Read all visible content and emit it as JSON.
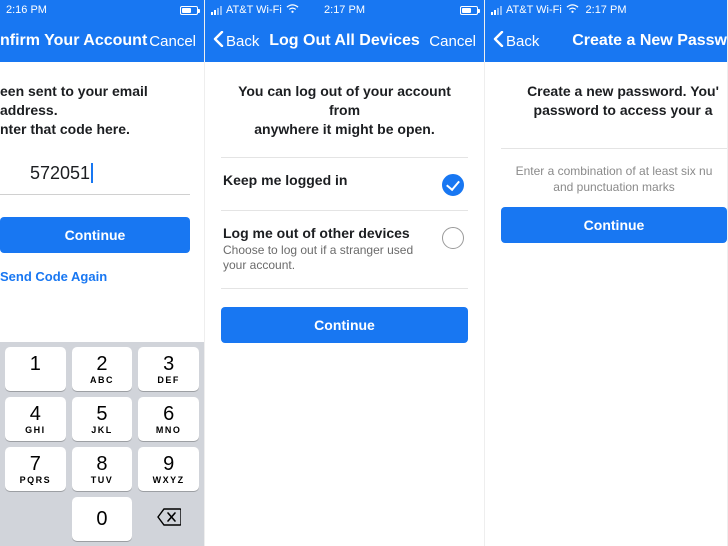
{
  "screen1": {
    "status": {
      "time": "2:16 PM"
    },
    "nav": {
      "title": "nfirm Your Account",
      "cancel": "Cancel"
    },
    "headline1": "een sent to your email address.",
    "headline2": "nter that code here.",
    "code_value": "572051",
    "continue": "Continue",
    "resend": "Send Code Again",
    "keys": {
      "k1": "1",
      "k2": "2",
      "k3": "3",
      "k4": "4",
      "k5": "5",
      "k6": "6",
      "k7": "7",
      "k8": "8",
      "k9": "9",
      "k0": "0",
      "l2": "ABC",
      "l3": "DEF",
      "l4": "GHI",
      "l5": "JKL",
      "l6": "MNO",
      "l7": "PQRS",
      "l8": "TUV",
      "l9": "WXYZ"
    }
  },
  "screen2": {
    "status": {
      "carrier": "AT&T Wi-Fi",
      "time": "2:17 PM"
    },
    "nav": {
      "back": "Back",
      "title": "Log Out All Devices",
      "cancel": "Cancel"
    },
    "headline1": "You can log out of your account from",
    "headline2": "anywhere it might be open.",
    "opt1_title": "Keep me logged in",
    "opt2_title": "Log me out of other devices",
    "opt2_sub": "Choose to log out if a stranger used your account.",
    "continue": "Continue"
  },
  "screen3": {
    "status": {
      "carrier": "AT&T Wi-Fi",
      "time": "2:17 PM"
    },
    "nav": {
      "back": "Back",
      "title": "Create a New Passw"
    },
    "headline1": "Create a new password. You'",
    "headline2": "password to access your a",
    "helper1": "Enter a combination of at least six nu",
    "helper2": "and punctuation marks",
    "continue": "Continue"
  }
}
